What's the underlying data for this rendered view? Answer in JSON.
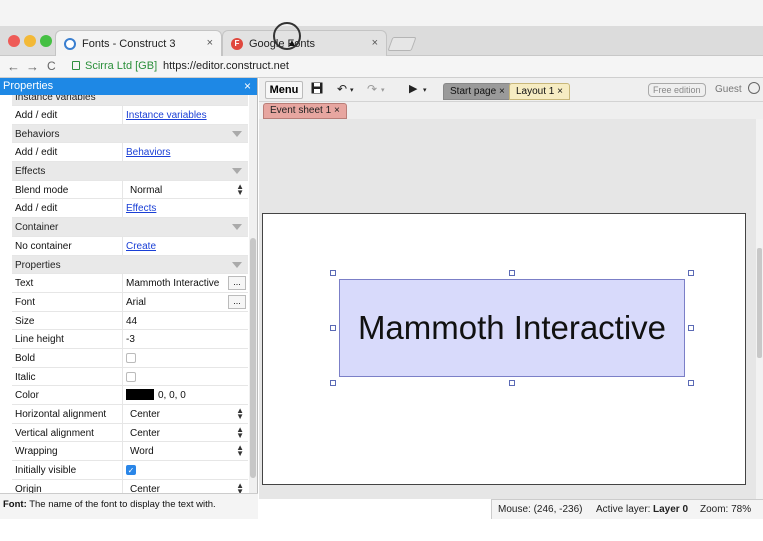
{
  "browser": {
    "tabs": [
      {
        "title": "Fonts - Construct 3",
        "active": true,
        "favicon": "construct3-icon"
      },
      {
        "title": "Google Fonts",
        "active": false,
        "favicon": "google-fonts-icon",
        "favicon_letter": "F"
      }
    ],
    "close_glyph": "×",
    "address": {
      "secure_label": "Scirra Ltd [GB]",
      "url": "https://editor.construct.net"
    },
    "nav": {
      "back": "←",
      "forward": "→",
      "reload": "C"
    }
  },
  "properties_panel": {
    "title": "Properties",
    "close_glyph": "×",
    "rows": {
      "instance_vars_header": "Instance variables",
      "iv_add_label": "Add / edit",
      "iv_link": "Instance variables",
      "behaviors_header": "Behaviors",
      "beh_add_label": "Add / edit",
      "beh_link": "Behaviors",
      "effects_header": "Effects",
      "blend_label": "Blend mode",
      "blend_value": "Normal",
      "eff_add_label": "Add / edit",
      "eff_link": "Effects",
      "container_header": "Container",
      "container_label": "No container",
      "container_link": "Create",
      "properties_header": "Properties",
      "text_label": "Text",
      "text_value": "Mammoth Interactive",
      "font_label": "Font",
      "font_value": "Arial",
      "size_label": "Size",
      "size_value": "44",
      "lineheight_label": "Line height",
      "lineheight_value": "-3",
      "bold_label": "Bold",
      "italic_label": "Italic",
      "color_label": "Color",
      "color_value": "0, 0, 0",
      "halign_label": "Horizontal alignment",
      "halign_value": "Center",
      "valign_label": "Vertical alignment",
      "valign_value": "Center",
      "wrap_label": "Wrapping",
      "wrap_value": "Word",
      "visible_label": "Initially visible",
      "origin_label": "Origin",
      "origin_value": "Center"
    },
    "ellipsis": "...",
    "checkmark": "✓",
    "bold_checked": false,
    "italic_checked": false,
    "visible_checked": true,
    "color_swatch": "#000000",
    "footer_key": "Font:",
    "footer_text": " The name of the font to display the text with."
  },
  "editor": {
    "menu_label": "Menu",
    "tabs": {
      "start": "Start page",
      "layout": "Layout 1",
      "eventsheet": "Event sheet 1"
    },
    "tab_close": "×",
    "free_edition": "Free edition",
    "user": "Guest",
    "canvas_text": "Mammoth Interactive",
    "status": {
      "mouse": "Mouse: (246, -236)",
      "layer_label": "Active layer:",
      "layer_value": "Layer 0",
      "zoom": "Zoom: 78%"
    }
  },
  "colors": {
    "panel_header": "#1e88e5",
    "link": "#1a3fd6",
    "text_object_fill": "#d8dafb",
    "layout_tab": "#f6ecc2",
    "eventsheet_tab": "#e7a6a0"
  }
}
